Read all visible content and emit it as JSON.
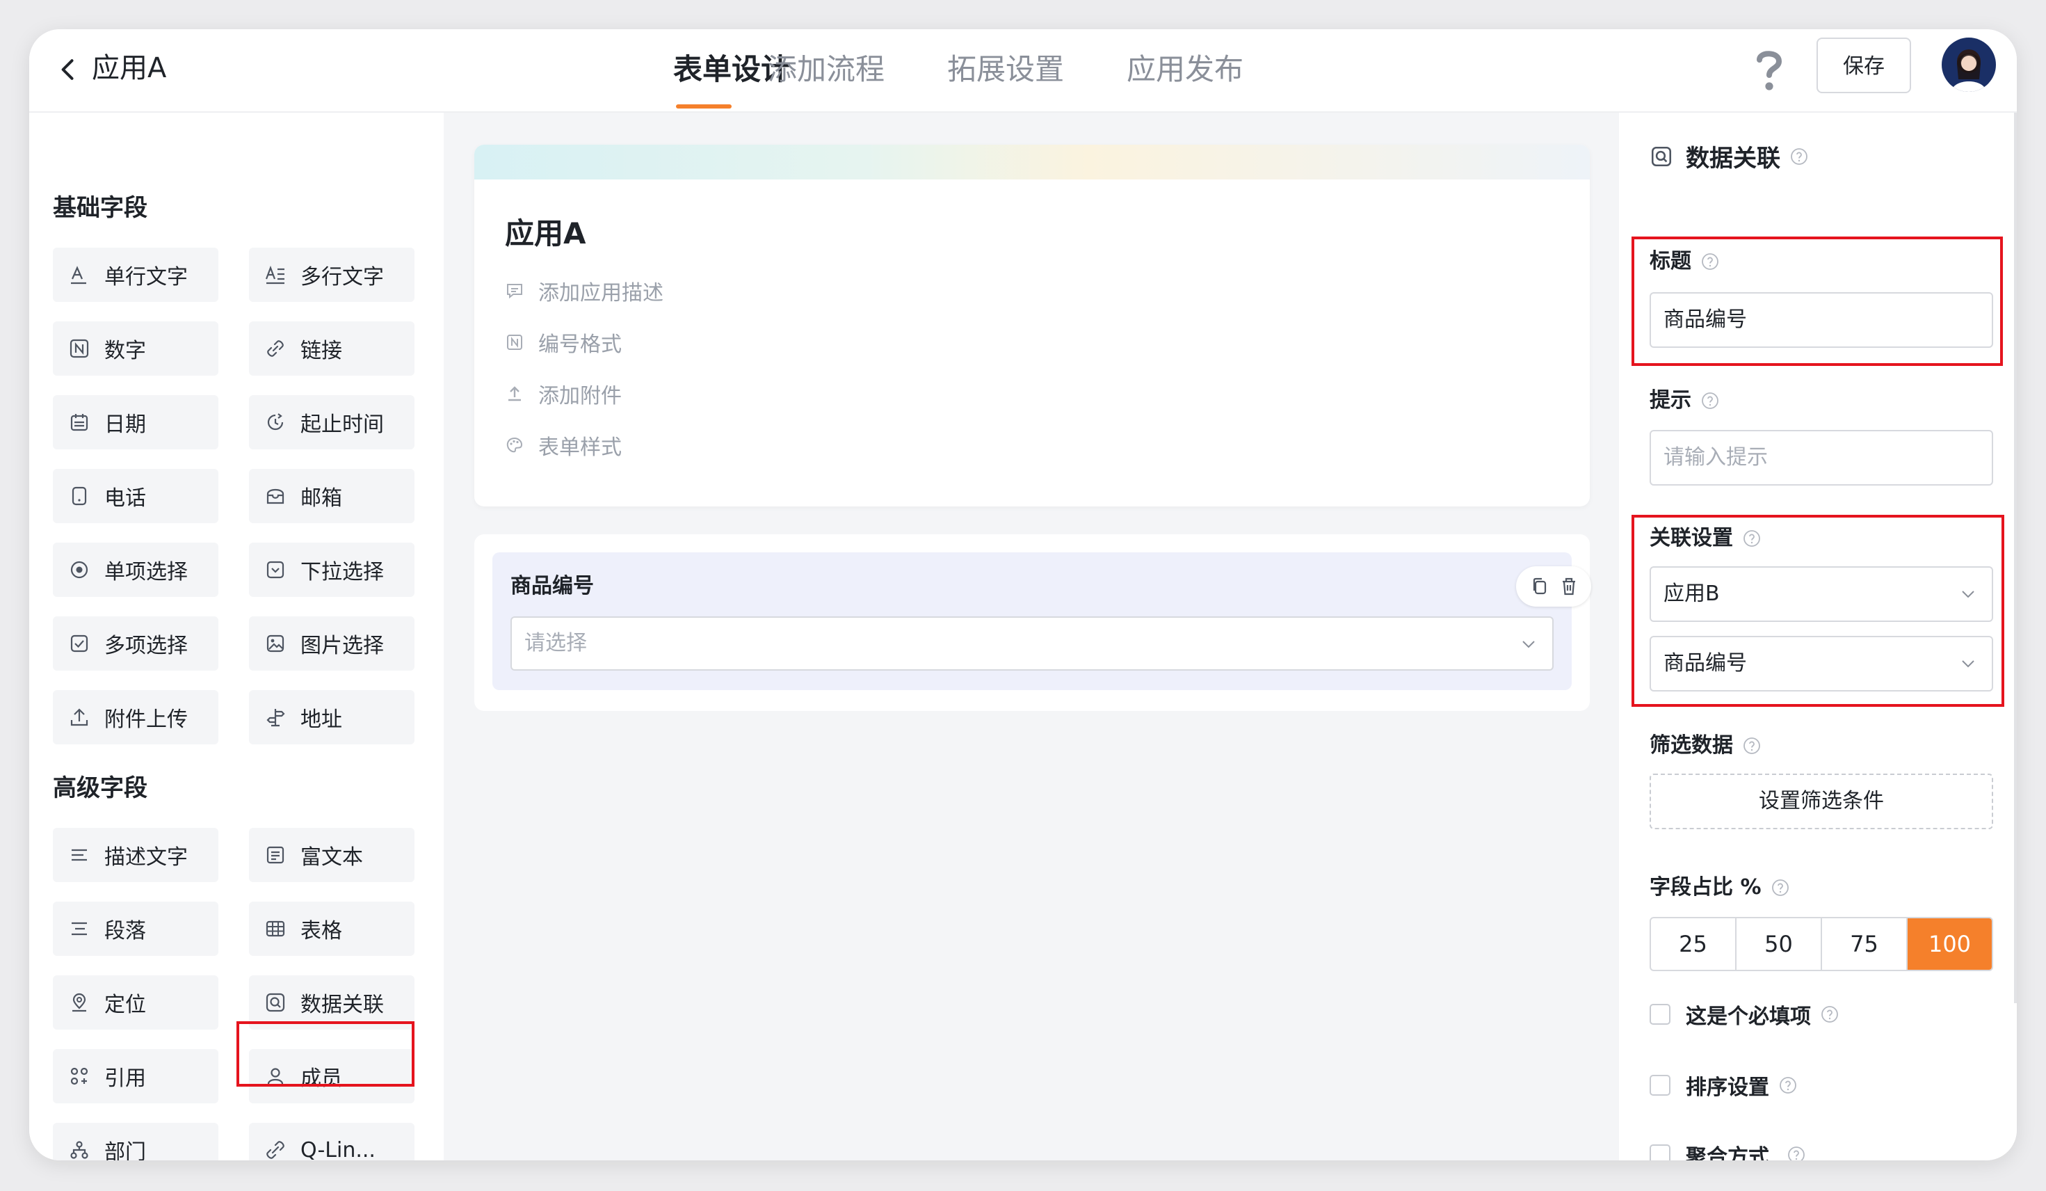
{
  "header": {
    "back_icon": "chevron-left-icon",
    "app_title": "应用A",
    "tabs": [
      {
        "label": "表单设计",
        "active": true
      },
      {
        "label": "添加流程",
        "active": false
      },
      {
        "label": "拓展设置",
        "active": false
      },
      {
        "label": "应用发布",
        "active": false
      }
    ],
    "help_icon": "question-mark-icon",
    "save_label": "保存",
    "accent_color": "#f5802b"
  },
  "left_panel": {
    "basic_title": "基础字段",
    "basic_fields": [
      {
        "label": "单行文字",
        "icon": "single-line-text-icon"
      },
      {
        "label": "多行文字",
        "icon": "multi-line-text-icon"
      },
      {
        "label": "数字",
        "icon": "number-icon"
      },
      {
        "label": "链接",
        "icon": "link-icon"
      },
      {
        "label": "日期",
        "icon": "calendar-icon"
      },
      {
        "label": "起止时间",
        "icon": "time-range-icon"
      },
      {
        "label": "电话",
        "icon": "phone-icon"
      },
      {
        "label": "邮箱",
        "icon": "mailbox-icon"
      },
      {
        "label": "单项选择",
        "icon": "radio-icon"
      },
      {
        "label": "下拉选择",
        "icon": "dropdown-icon"
      },
      {
        "label": "多项选择",
        "icon": "checkbox-icon"
      },
      {
        "label": "图片选择",
        "icon": "image-icon"
      },
      {
        "label": "附件上传",
        "icon": "upload-icon"
      },
      {
        "label": "地址",
        "icon": "signpost-icon"
      }
    ],
    "advanced_title": "高级字段",
    "advanced_fields": [
      {
        "label": "描述文字",
        "icon": "description-icon"
      },
      {
        "label": "富文本",
        "icon": "rich-text-icon"
      },
      {
        "label": "段落",
        "icon": "paragraph-icon"
      },
      {
        "label": "表格",
        "icon": "table-icon"
      },
      {
        "label": "定位",
        "icon": "location-pin-icon"
      },
      {
        "label": "数据关联",
        "icon": "data-link-icon"
      },
      {
        "label": "引用",
        "icon": "reference-icon"
      },
      {
        "label": "成员",
        "icon": "member-icon"
      },
      {
        "label": "部门",
        "icon": "department-icon"
      },
      {
        "label": "Q-Lin...",
        "icon": "q-link-icon"
      }
    ]
  },
  "canvas": {
    "form_title": "应用A",
    "meta": [
      {
        "label": "添加应用描述",
        "icon": "comment-icon"
      },
      {
        "label": "编号格式",
        "icon": "number-format-icon"
      },
      {
        "label": "添加附件",
        "icon": "attachment-upload-icon"
      },
      {
        "label": "表单样式",
        "icon": "palette-icon"
      }
    ],
    "field": {
      "label": "商品编号",
      "placeholder": "请选择",
      "copy_icon": "copy-icon",
      "delete_icon": "trash-icon"
    }
  },
  "right_panel": {
    "header": "数据关联",
    "title_label": "标题",
    "title_value": "商品编号",
    "hint_label": "提示",
    "hint_placeholder": "请输入提示",
    "assoc_label": "关联设置",
    "assoc_app": "应用B",
    "assoc_field": "商品编号",
    "filter_label": "筛选数据",
    "filter_button": "设置筛选条件",
    "ratio_label": "字段占比 %",
    "ratio_options": [
      "25",
      "50",
      "75",
      "100"
    ],
    "ratio_selected": "100",
    "checks": [
      "这是个必填项",
      "排序设置",
      "聚合方式"
    ]
  },
  "annotation_color": "#e5141e"
}
